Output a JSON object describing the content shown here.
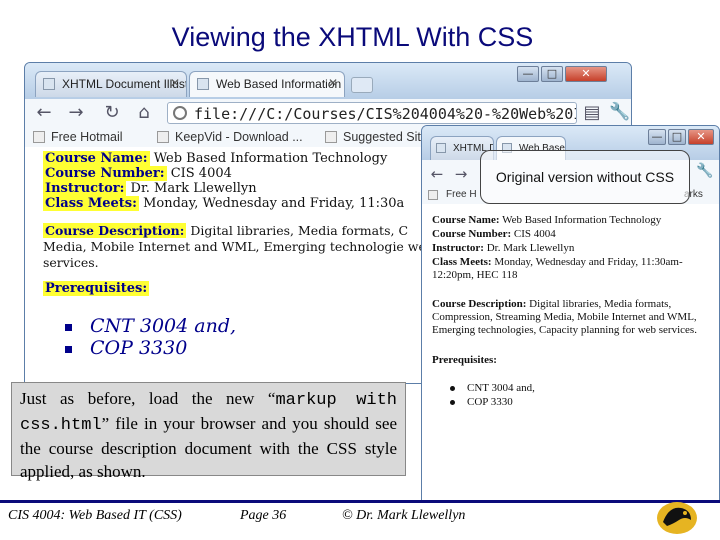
{
  "slide": {
    "title": "Viewing the XHTML With CSS"
  },
  "browser_with_css": {
    "tabs": [
      {
        "label": "XHTML Document Illustr...",
        "close": "✕"
      },
      {
        "label": "Web Based Information T...",
        "close": "✕"
      }
    ],
    "window_controls": {
      "minimize": "—",
      "maximize": "□",
      "close": "✕"
    },
    "address": "file:///C:/Courses/CIS%204004%20-%20Web%20I",
    "bookmarks": [
      "Free Hotmail",
      "KeepVid - Download ...",
      "Suggested Sit"
    ],
    "page": {
      "course_name_label": "Course Name:",
      "course_name_value": "Web Based Information Technology",
      "course_number_label": "Course Number:",
      "course_number_value": "CIS 4004",
      "instructor_label": "Instructor:",
      "instructor_value": "Dr. Mark Llewellyn",
      "class_meets_label": "Class Meets:",
      "class_meets_value": "Monday, Wednesday and Friday, 11:30a",
      "description_label": "Course Description:",
      "description_value": "Digital libraries, Media formats, C Media, Mobile Internet and WML, Emerging technologie web services.",
      "prerequisites_label": "Prerequisites:",
      "prerequisites": [
        "CNT 3004 and,",
        "COP 3330"
      ]
    }
  },
  "browser_without_css": {
    "tabs": [
      {
        "label": "XHTML Doc"
      },
      {
        "label": "Web Based I"
      }
    ],
    "window_controls": {
      "minimize": "—",
      "maximize": "□",
      "close": "✕"
    },
    "bookmarks": [
      "Free H",
      "arks"
    ],
    "page": {
      "course_name_label": "Course Name:",
      "course_name_value": "Web Based Information Technology",
      "course_number_label": "Course Number:",
      "course_number_value": "CIS 4004",
      "instructor_label": "Instructor:",
      "instructor_value": "Dr. Mark Llewellyn",
      "class_meets_label": "Class Meets:",
      "class_meets_value": "Monday, Wednesday and Friday, 11:30am-12:20pm, HEC 118",
      "description_label": "Course Description:",
      "description_value": "Digital libraries, Media formats, Compression, Streaming Media, Mobile Internet and WML, Emerging technologies, Capacity planning for web services.",
      "prerequisites_label": "Prerequisites:",
      "prerequisites": [
        "CNT 3004 and,",
        "COP 3330"
      ]
    }
  },
  "callout": {
    "text": "Original version without CSS"
  },
  "explanation": {
    "part1": "Just as before, load the new “",
    "mono": "markup with css.html",
    "part2": "” file in your browser and you should see the course description document with the CSS style applied, as shown."
  },
  "footer": {
    "course": "CIS 4004: Web Based IT (CSS)",
    "page": "Page 36",
    "author": "© Dr. Mark Llewellyn"
  },
  "colors": {
    "title_blue": "#0a0a7a",
    "label_highlight": "#ffff33",
    "label_text": "#00008b",
    "logo_gold": "#e6b422"
  }
}
